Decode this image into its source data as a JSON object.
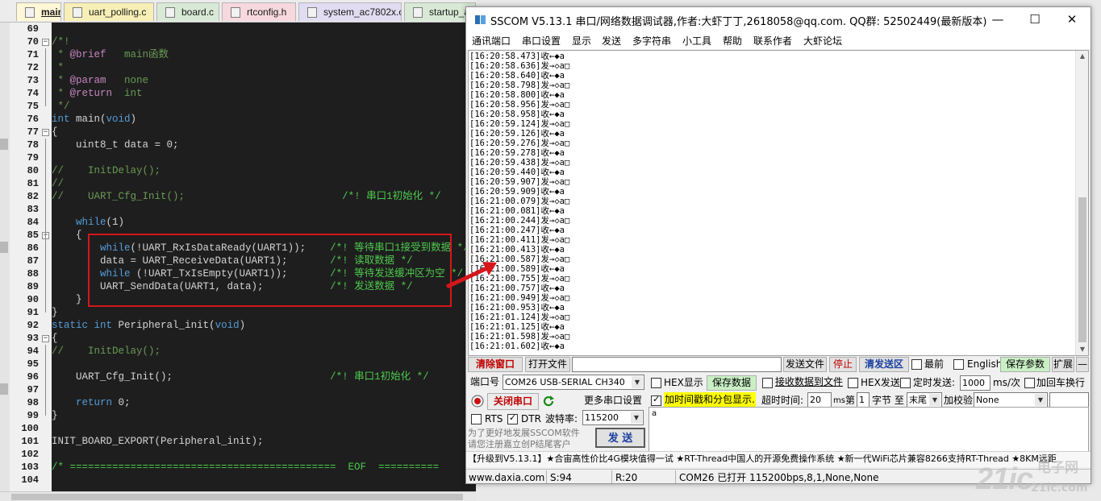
{
  "editor": {
    "tabs": [
      {
        "label": "main.c",
        "active": true,
        "color": "#fff7d6"
      },
      {
        "label": "uart_polling.c",
        "color": "#f7efb6"
      },
      {
        "label": "board.c",
        "color": "#d8ead5"
      },
      {
        "label": "rtconfig.h",
        "color": "#f7d8de"
      },
      {
        "label": "system_ac7802x.c",
        "color": "#e1dcf1"
      },
      {
        "label": "startup_a",
        "color": "#d8ead5"
      }
    ],
    "lines": [
      {
        "n": "69",
        "html": ""
      },
      {
        "n": "70",
        "html": "<span class='cm'>/*!</span>"
      },
      {
        "n": "71",
        "html": "<span class='cm'> * <span class='tag'>@brief</span>   main函数</span>"
      },
      {
        "n": "72",
        "html": "<span class='cm'> *</span>"
      },
      {
        "n": "73",
        "html": "<span class='cm'> * <span class='tag'>@param</span>   none</span>"
      },
      {
        "n": "74",
        "html": "<span class='cm'> * <span class='tag'>@return</span>  int</span>"
      },
      {
        "n": "75",
        "html": "<span class='cm'> */</span>"
      },
      {
        "n": "76",
        "html": "<span class='kw'>int</span> main(<span class='kw'>void</span>)"
      },
      {
        "n": "77",
        "html": "{"
      },
      {
        "n": "78",
        "html": "    uint8_t data = 0;"
      },
      {
        "n": "79",
        "html": ""
      },
      {
        "n": "80",
        "html": "<span class='cm'>//    InitDelay();</span>"
      },
      {
        "n": "81",
        "html": "<span class='cm'>//</span>"
      },
      {
        "n": "82",
        "html": "<span class='cm'>//    UART_Cfg_Init();</span>                          <span class='cm2'>/*! 串口1初始化 */</span>"
      },
      {
        "n": "83",
        "html": ""
      },
      {
        "n": "84",
        "html": "    <span class='kw'>while</span>(1)"
      },
      {
        "n": "85",
        "html": "    {"
      },
      {
        "n": "86",
        "html": "        <span class='kw'>while</span>(!UART_RxIsDataReady(UART1));    <span class='cm2'>/*! 等待串口1接受到数据 */</span>"
      },
      {
        "n": "87",
        "html": "        data = UART_ReceiveData(UART1);       <span class='cm2'>/*! 读取数据 */</span>"
      },
      {
        "n": "88",
        "html": "        <span class='kw'>while</span> (!UART_TxIsEmpty(UART1));       <span class='cm2'>/*! 等待发送缓冲区为空 */</span>"
      },
      {
        "n": "89",
        "html": "        UART_SendData(UART1, data);           <span class='cm2'>/*! 发送数据 */</span>"
      },
      {
        "n": "90",
        "html": "    }"
      },
      {
        "n": "91",
        "html": "}"
      },
      {
        "n": "92",
        "html": "<span class='kw'>static</span> <span class='kw'>int</span> Peripheral_init(<span class='kw'>void</span>)"
      },
      {
        "n": "93",
        "html": "{"
      },
      {
        "n": "94",
        "html": "<span class='cm'>//    InitDelay();</span>"
      },
      {
        "n": "95",
        "html": ""
      },
      {
        "n": "96",
        "html": "    UART_Cfg_Init();                          <span class='cm2'>/*! 串口1初始化 */</span>"
      },
      {
        "n": "97",
        "html": ""
      },
      {
        "n": "98",
        "html": "    <span class='kw'>return</span> 0;"
      },
      {
        "n": "99",
        "html": "}"
      },
      {
        "n": "100",
        "html": ""
      },
      {
        "n": "101",
        "html": "INIT_BOARD_EXPORT(Peripheral_init);"
      },
      {
        "n": "102",
        "html": ""
      },
      {
        "n": "103",
        "html": "<span class='cm2'>/* ============================================  EOF  ==========</span>"
      },
      {
        "n": "104",
        "html": ""
      }
    ]
  },
  "sscom": {
    "title": "SSCOM V5.13.1 串口/网络数据调试器,作者:大虾丁丁,2618058@qq.com. QQ群: 52502449(最新版本)",
    "window_controls": {
      "minimize": "—",
      "maximize": "☐",
      "close": "✕"
    },
    "menu": [
      "通讯端口",
      "串口设置",
      "显示",
      "发送",
      "多字符串",
      "小工具",
      "帮助",
      "联系作者",
      "大虾论坛"
    ],
    "log": [
      "[16:20:58.473]收←◆a",
      "[16:20:58.636]发→◇a□",
      "[16:20:58.640]收←◆a",
      "[16:20:58.798]发→◇a□",
      "[16:20:58.800]收←◆a",
      "[16:20:58.956]发→◇a□",
      "[16:20:58.958]收←◆a",
      "[16:20:59.124]发→◇a□",
      "[16:20:59.126]收←◆a",
      "[16:20:59.276]发→◇a□",
      "[16:20:59.278]收←◆a",
      "[16:20:59.438]发→◇a□",
      "[16:20:59.440]收←◆a",
      "[16:20:59.907]发→◇a□",
      "[16:20:59.909]收←◆a",
      "[16:21:00.079]发→◇a□",
      "[16:21:00.081]收←◆a",
      "[16:21:00.244]发→◇a□",
      "[16:21:00.247]收←◆a",
      "[16:21:00.411]发→◇a□",
      "[16:21:00.413]收←◆a",
      "[16:21:00.587]发→◇a□",
      "[16:21:00.589]收←◆a",
      "[16:21:00.755]发→◇a□",
      "[16:21:00.757]收←◆a",
      "[16:21:00.949]发→◇a□",
      "[16:21:00.953]收←◆a",
      "[16:21:01.124]发→◇a□",
      "[16:21:01.125]收←◆a",
      "[16:21:01.598]发→◇a□",
      "[16:21:01.602]收←◆a"
    ],
    "toolbar": {
      "clear": "清除窗口",
      "open_file": "打开文件",
      "send_file": "发送文件",
      "stop": "停止",
      "clear_send": "清发送区",
      "last_label": "最前",
      "english_label": "English",
      "save_params": "保存参数",
      "expand": "扩展",
      "dash": "—"
    },
    "port": {
      "label": "端口号",
      "value": "COM26 USB-SERIAL CH340",
      "hex_display": "HEX显示",
      "save_data": "保存数据",
      "recv_to_file": "接收数据到文件",
      "hex_send": "HEX发送",
      "timed_send": "定时发送:",
      "interval": "1000",
      "interval_unit": "ms/次",
      "crlf": "加回车换行",
      "close_port": "关闭串口",
      "more_settings": "更多串口设置",
      "timestamp": "加时间戳和分包显示.",
      "timeout_label": "超时时间:",
      "timeout": "20",
      "ms": "ms",
      "nth_label": "第",
      "byte_from": "1",
      "byte_label": "字节 至",
      "byte_to": "末尾",
      "checksum_label": "加校验",
      "checksum": "None",
      "rts": "RTS",
      "dtr": "DTR",
      "baud_label": "波特率:",
      "baud": "115200",
      "promo_line1": "为了更好地发展SSCOM软件",
      "promo_line2": "请您注册嘉立创P结尾客户",
      "send": "发 送",
      "send_content": "a"
    },
    "ticker": "【升级到V5.13.1】★合宙高性价比4G模块值得一试 ★RT-Thread中国人的开源免费操作系统 ★新一代WiFi芯片兼容8266支持RT-Thread ★8KM远距",
    "status": {
      "site": "www.daxia.com",
      "sent": "S:94",
      "received": "R:20",
      "port_status": "COM26 已打开  115200bps,8,1,None,None"
    }
  },
  "watermark": {
    "main": "21ic",
    "top": "电子网",
    "sub": "21ic.com"
  },
  "colors": {
    "accent_red": "#d6161b",
    "highlight_yellow": "#ffff00",
    "code_bg": "#1e1e1e"
  }
}
